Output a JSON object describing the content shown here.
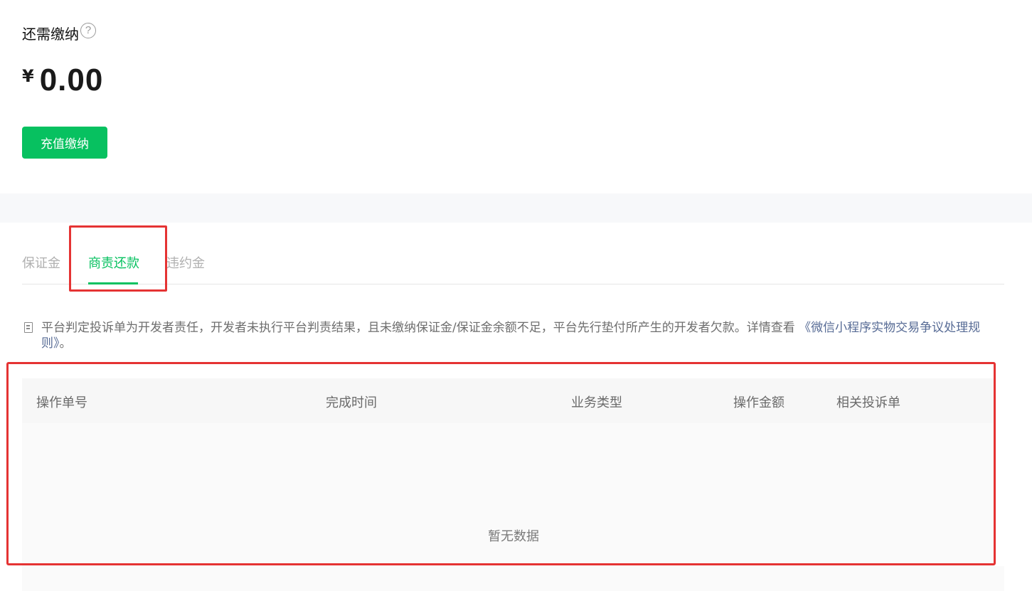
{
  "summary": {
    "title": "还需缴纳",
    "help_icon": "?",
    "currency": "¥",
    "amount": "0.00",
    "pay_button": "充值缴纳"
  },
  "tabs": [
    {
      "label": "保证金",
      "active": false
    },
    {
      "label": "商责还款",
      "active": true
    },
    {
      "label": "违约金",
      "active": false
    }
  ],
  "notice": {
    "text": "平台判定投诉单为开发者责任，开发者未执行平台判责结果，且未缴纳保证金/保证金余额不足，平台先行垫付所产生的开发者欠款。详情查看",
    "link": "《微信小程序实物交易争议处理规则》",
    "suffix": "。"
  },
  "table": {
    "columns": [
      "操作单号",
      "完成时间",
      "业务类型",
      "操作金额",
      "相关投诉单"
    ],
    "empty_text": "暂无数据"
  },
  "colors": {
    "brand_green": "#07c160",
    "annotation_red": "#e53333",
    "link_blue": "#576b95"
  }
}
